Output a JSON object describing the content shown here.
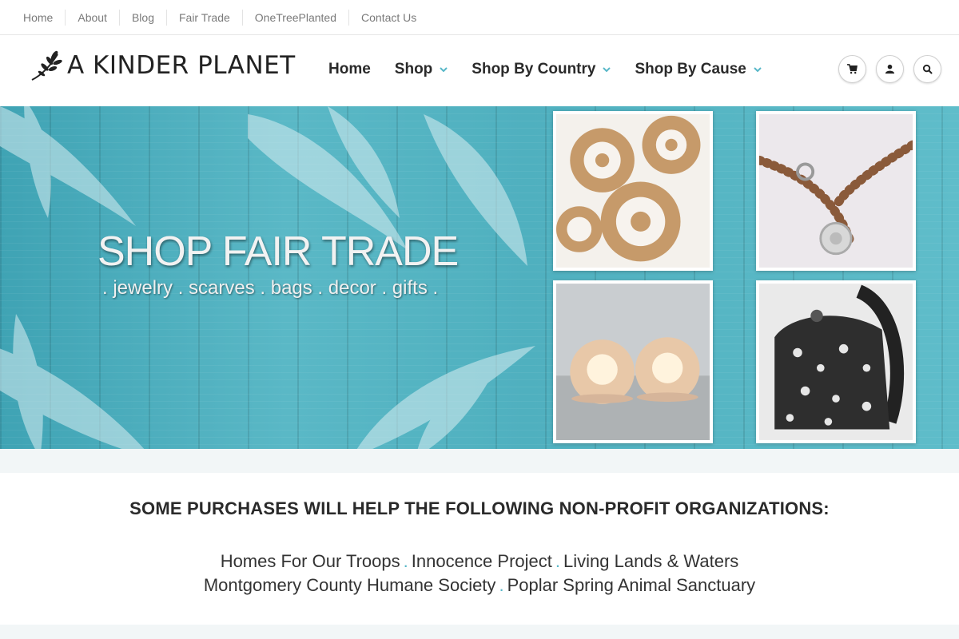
{
  "topbar": {
    "links": [
      "Home",
      "About",
      "Blog",
      "Fair Trade",
      "OneTreePlanted",
      "Contact Us"
    ]
  },
  "header": {
    "logo_text": "A KINDER PLANET",
    "nav": [
      {
        "label": "Home"
      },
      {
        "label": "Shop"
      },
      {
        "label": "Shop By Country"
      },
      {
        "label": "Shop By Cause"
      }
    ],
    "icons": [
      "cart-icon",
      "user-icon",
      "search-icon"
    ]
  },
  "hero": {
    "title": "SHOP FAIR TRADE",
    "subtitle": ". jewelry . scarves . bags . decor . gifts ."
  },
  "partners": {
    "heading": "SOME PURCHASES WILL HELP THE FOLLOWING NON-PROFIT ORGANIZATIONS:",
    "orgs": [
      "Homes For Our Troops",
      "Innocence Project",
      "Living Lands & Waters",
      "Montgomery County Humane Society",
      "Poplar Spring Animal Sanctuary"
    ]
  },
  "colors": {
    "accent": "#58b7c8",
    "hero_wood": "#4fb0bf",
    "text_dark": "#2a2a2a"
  }
}
